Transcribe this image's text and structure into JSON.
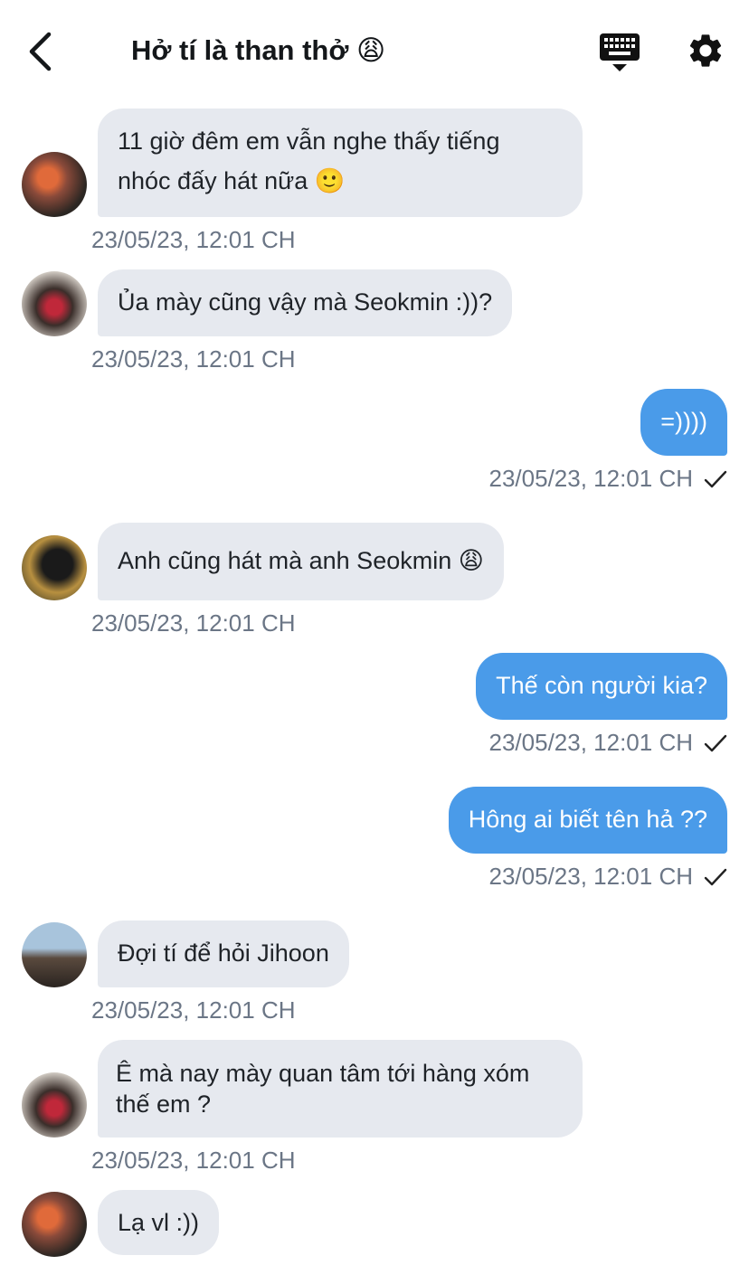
{
  "header": {
    "title": "Hở tí là than thở 😩",
    "icons": [
      "back-chevron-icon",
      "keyboard-icon",
      "gear-icon"
    ]
  },
  "messages": [
    {
      "side": "in",
      "text_lines": [
        "11 giờ đêm em vẫn nghe thấy tiếng",
        "nhóc đấy hát nữa 🙂"
      ],
      "time": "23/05/23, 12:01 CH"
    },
    {
      "side": "in",
      "text": "Ủa mày cũng vậy mà Seokmin :))?",
      "time": "23/05/23, 12:01 CH"
    },
    {
      "side": "out",
      "text": "=))))",
      "time": "23/05/23, 12:01 CH"
    },
    {
      "side": "in",
      "text": "Anh cũng hát mà anh Seokmin 😩",
      "time": "23/05/23, 12:01 CH"
    },
    {
      "side": "out",
      "text": "Thế còn người kia?",
      "time": "23/05/23, 12:01 CH"
    },
    {
      "side": "out",
      "text": "Hông ai biết tên hả ??",
      "time": "23/05/23, 12:01 CH"
    },
    {
      "side": "in",
      "text": "Đợi tí để hỏi Jihoon",
      "time": "23/05/23, 12:01 CH"
    },
    {
      "side": "in",
      "text_lines": [
        "Ê mà nay mày quan tâm tới hàng xóm",
        "thế em ?"
      ],
      "time": "23/05/23, 12:01 CH"
    },
    {
      "side": "in",
      "text": "Lạ vl :))"
    }
  ],
  "colors": {
    "incoming_bubble": "#e6e9ef",
    "outgoing_bubble": "#4a9be9",
    "timestamp": "#6b7686"
  }
}
